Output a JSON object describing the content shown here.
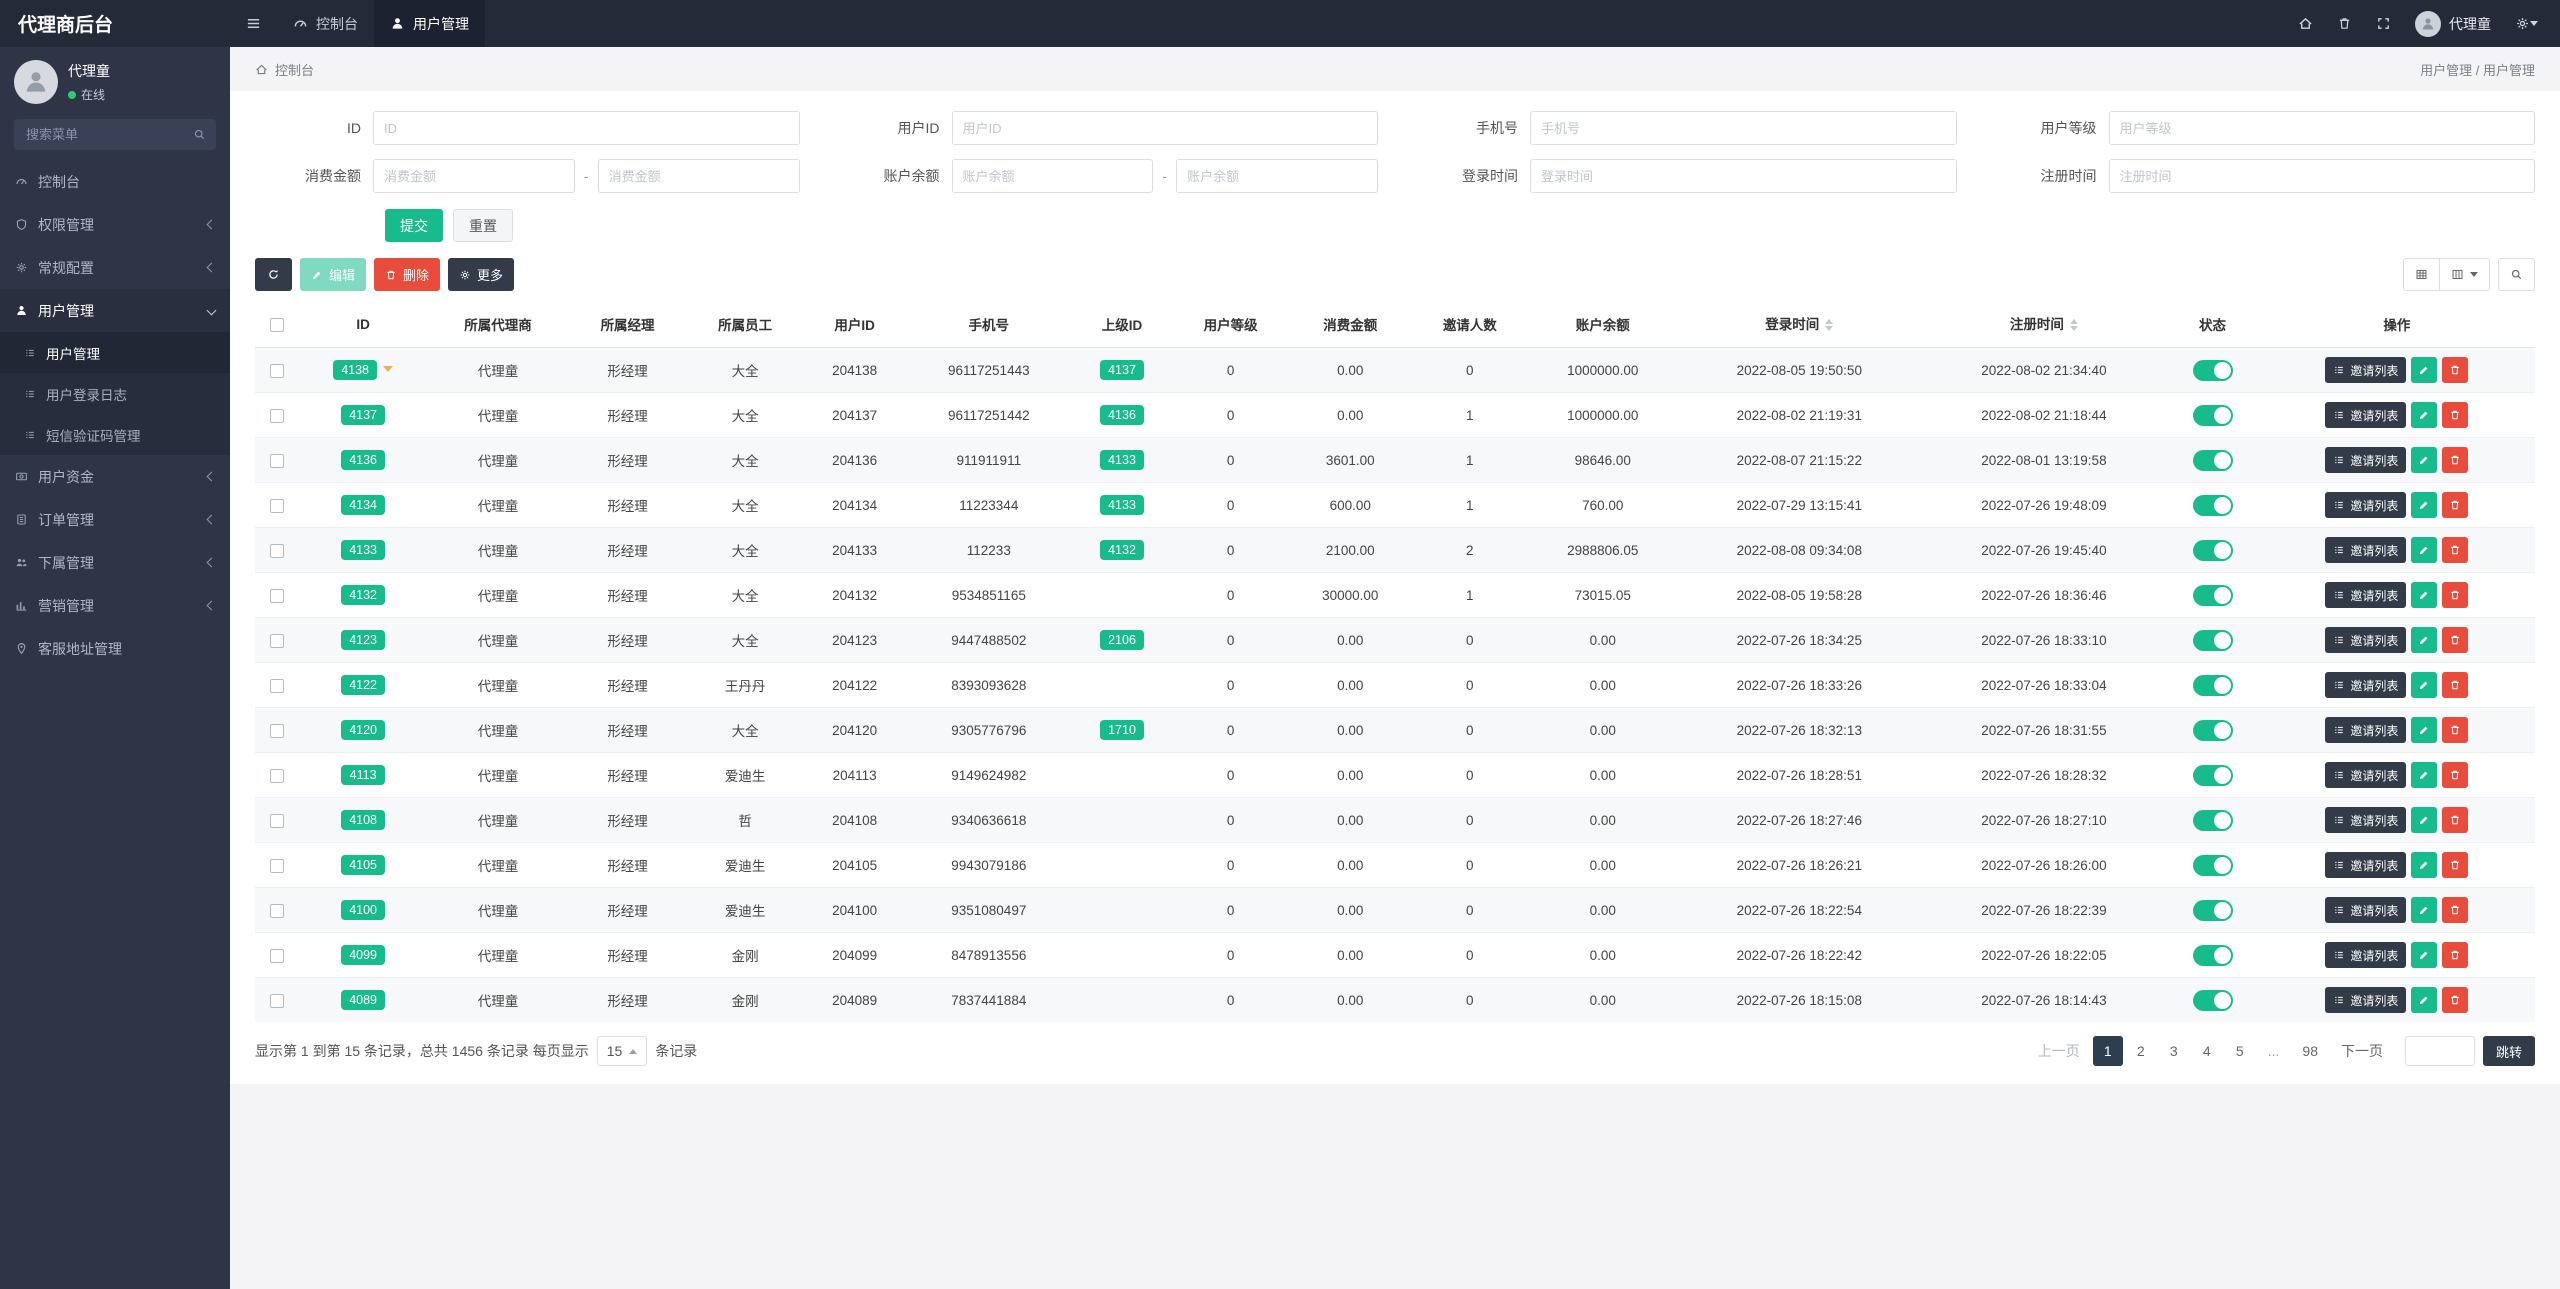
{
  "colors": {
    "green": "#18bc8c",
    "red": "#e74c3c",
    "dark": "#333a48",
    "navy": "#2c3e50",
    "orange": "#f0ad4e"
  },
  "navbar": {
    "brand": "代理商后台",
    "menu": [
      {
        "label": "控制台"
      },
      {
        "label": "用户管理"
      }
    ],
    "username": "代理童"
  },
  "sidebar": {
    "user": {
      "name": "代理童",
      "status": "在线"
    },
    "search_placeholder": "搜索菜单",
    "menu": [
      {
        "label": "控制台",
        "icon": "gauge"
      },
      {
        "label": "权限管理",
        "icon": "shield",
        "chevron": "left"
      },
      {
        "label": "常规配置",
        "icon": "gear",
        "chevron": "left"
      },
      {
        "label": "用户管理",
        "icon": "user",
        "chevron": "down",
        "active": true,
        "children": [
          {
            "label": "用户管理",
            "active": true
          },
          {
            "label": "用户登录日志"
          },
          {
            "label": "短信验证码管理"
          }
        ]
      },
      {
        "label": "用户资金",
        "icon": "money",
        "chevron": "left"
      },
      {
        "label": "订单管理",
        "icon": "order",
        "chevron": "left"
      },
      {
        "label": "下属管理",
        "icon": "users",
        "chevron": "left"
      },
      {
        "label": "营销管理",
        "icon": "chart",
        "chevron": "left"
      },
      {
        "label": "客服地址管理",
        "icon": "pin"
      }
    ]
  },
  "breadcrumb": {
    "left": "控制台",
    "right": "用户管理 / 用户管理"
  },
  "filters": {
    "fields": [
      {
        "label": "ID",
        "placeholder": "ID"
      },
      {
        "label": "用户ID",
        "placeholder": "用户ID"
      },
      {
        "label": "手机号",
        "placeholder": "手机号"
      },
      {
        "label": "用户等级",
        "placeholder": "用户等级"
      },
      {
        "label": "消费金额",
        "placeholder": "消费金额",
        "range": true
      },
      {
        "label": "账户余额",
        "placeholder": "账户余额",
        "range": true
      },
      {
        "label": "登录时间",
        "placeholder": "登录时间"
      },
      {
        "label": "注册时间",
        "placeholder": "注册时间"
      }
    ],
    "submit": "提交",
    "reset": "重置"
  },
  "toolbar": {
    "edit": "编辑",
    "delete": "删除",
    "more": "更多"
  },
  "table": {
    "invite_label": "邀请列表",
    "columns": [
      {
        "label": "ID"
      },
      {
        "label": "所属代理商"
      },
      {
        "label": "所属经理"
      },
      {
        "label": "所属员工"
      },
      {
        "label": "用户ID"
      },
      {
        "label": "手机号"
      },
      {
        "label": "上级ID"
      },
      {
        "label": "用户等级"
      },
      {
        "label": "消费金额"
      },
      {
        "label": "邀请人数"
      },
      {
        "label": "账户余额"
      },
      {
        "label": "登录时间",
        "sortable": true
      },
      {
        "label": "注册时间",
        "sortable": true
      },
      {
        "label": "状态"
      },
      {
        "label": "操作"
      }
    ],
    "rows": [
      {
        "id": "4138",
        "agent": "代理童",
        "manager": "形经理",
        "staff": "大全",
        "uid": "204138",
        "phone": "96117251443",
        "pid": "4137",
        "level": "0",
        "consume": "0.00",
        "invites": "0",
        "balance": "1000000.00",
        "login": "2022-08-05 19:50:50",
        "reg": "2022-08-02 21:34:40"
      },
      {
        "id": "4137",
        "agent": "代理童",
        "manager": "形经理",
        "staff": "大全",
        "uid": "204137",
        "phone": "96117251442",
        "pid": "4136",
        "level": "0",
        "consume": "0.00",
        "invites": "1",
        "balance": "1000000.00",
        "login": "2022-08-02 21:19:31",
        "reg": "2022-08-02 21:18:44"
      },
      {
        "id": "4136",
        "agent": "代理童",
        "manager": "形经理",
        "staff": "大全",
        "uid": "204136",
        "phone": "911911911",
        "pid": "4133",
        "level": "0",
        "consume": "3601.00",
        "invites": "1",
        "balance": "98646.00",
        "login": "2022-08-07 21:15:22",
        "reg": "2022-08-01 13:19:58"
      },
      {
        "id": "4134",
        "agent": "代理童",
        "manager": "形经理",
        "staff": "大全",
        "uid": "204134",
        "phone": "11223344",
        "pid": "4133",
        "level": "0",
        "consume": "600.00",
        "invites": "1",
        "balance": "760.00",
        "login": "2022-07-29 13:15:41",
        "reg": "2022-07-26 19:48:09"
      },
      {
        "id": "4133",
        "agent": "代理童",
        "manager": "形经理",
        "staff": "大全",
        "uid": "204133",
        "phone": "112233",
        "pid": "4132",
        "level": "0",
        "consume": "2100.00",
        "invites": "2",
        "balance": "2988806.05",
        "login": "2022-08-08 09:34:08",
        "reg": "2022-07-26 19:45:40"
      },
      {
        "id": "4132",
        "agent": "代理童",
        "manager": "形经理",
        "staff": "大全",
        "uid": "204132",
        "phone": "9534851165",
        "pid": "",
        "level": "0",
        "consume": "30000.00",
        "invites": "1",
        "balance": "73015.05",
        "login": "2022-08-05 19:58:28",
        "reg": "2022-07-26 18:36:46"
      },
      {
        "id": "4123",
        "agent": "代理童",
        "manager": "形经理",
        "staff": "大全",
        "uid": "204123",
        "phone": "9447488502",
        "pid": "2106",
        "level": "0",
        "consume": "0.00",
        "invites": "0",
        "balance": "0.00",
        "login": "2022-07-26 18:34:25",
        "reg": "2022-07-26 18:33:10"
      },
      {
        "id": "4122",
        "agent": "代理童",
        "manager": "形经理",
        "staff": "王丹丹",
        "uid": "204122",
        "phone": "8393093628",
        "pid": "",
        "level": "0",
        "consume": "0.00",
        "invites": "0",
        "balance": "0.00",
        "login": "2022-07-26 18:33:26",
        "reg": "2022-07-26 18:33:04"
      },
      {
        "id": "4120",
        "agent": "代理童",
        "manager": "形经理",
        "staff": "大全",
        "uid": "204120",
        "phone": "9305776796",
        "pid": "1710",
        "level": "0",
        "consume": "0.00",
        "invites": "0",
        "balance": "0.00",
        "login": "2022-07-26 18:32:13",
        "reg": "2022-07-26 18:31:55"
      },
      {
        "id": "4113",
        "agent": "代理童",
        "manager": "形经理",
        "staff": "爱迪生",
        "uid": "204113",
        "phone": "9149624982",
        "pid": "",
        "level": "0",
        "consume": "0.00",
        "invites": "0",
        "balance": "0.00",
        "login": "2022-07-26 18:28:51",
        "reg": "2022-07-26 18:28:32"
      },
      {
        "id": "4108",
        "agent": "代理童",
        "manager": "形经理",
        "staff": "哲",
        "uid": "204108",
        "phone": "9340636618",
        "pid": "",
        "level": "0",
        "consume": "0.00",
        "invites": "0",
        "balance": "0.00",
        "login": "2022-07-26 18:27:46",
        "reg": "2022-07-26 18:27:10"
      },
      {
        "id": "4105",
        "agent": "代理童",
        "manager": "形经理",
        "staff": "爱迪生",
        "uid": "204105",
        "phone": "9943079186",
        "pid": "",
        "level": "0",
        "consume": "0.00",
        "invites": "0",
        "balance": "0.00",
        "login": "2022-07-26 18:26:21",
        "reg": "2022-07-26 18:26:00"
      },
      {
        "id": "4100",
        "agent": "代理童",
        "manager": "形经理",
        "staff": "爱迪生",
        "uid": "204100",
        "phone": "9351080497",
        "pid": "",
        "level": "0",
        "consume": "0.00",
        "invites": "0",
        "balance": "0.00",
        "login": "2022-07-26 18:22:54",
        "reg": "2022-07-26 18:22:39"
      },
      {
        "id": "4099",
        "agent": "代理童",
        "manager": "形经理",
        "staff": "金刚",
        "uid": "204099",
        "phone": "8478913556",
        "pid": "",
        "level": "0",
        "consume": "0.00",
        "invites": "0",
        "balance": "0.00",
        "login": "2022-07-26 18:22:42",
        "reg": "2022-07-26 18:22:05"
      },
      {
        "id": "4089",
        "agent": "代理童",
        "manager": "形经理",
        "staff": "金刚",
        "uid": "204089",
        "phone": "7837441884",
        "pid": "",
        "level": "0",
        "consume": "0.00",
        "invites": "0",
        "balance": "0.00",
        "login": "2022-07-26 18:15:08",
        "reg": "2022-07-26 18:14:43"
      }
    ]
  },
  "footer": {
    "summary_prefix": "显示第 1 到第 15 条记录，总共 1456 条记录 每页显示",
    "page_size": "15",
    "summary_suffix": "条记录",
    "pages": [
      "上一页",
      "1",
      "2",
      "3",
      "4",
      "5",
      "...",
      "98",
      "下一页"
    ],
    "active_page": "1",
    "jump_label": "跳转"
  }
}
